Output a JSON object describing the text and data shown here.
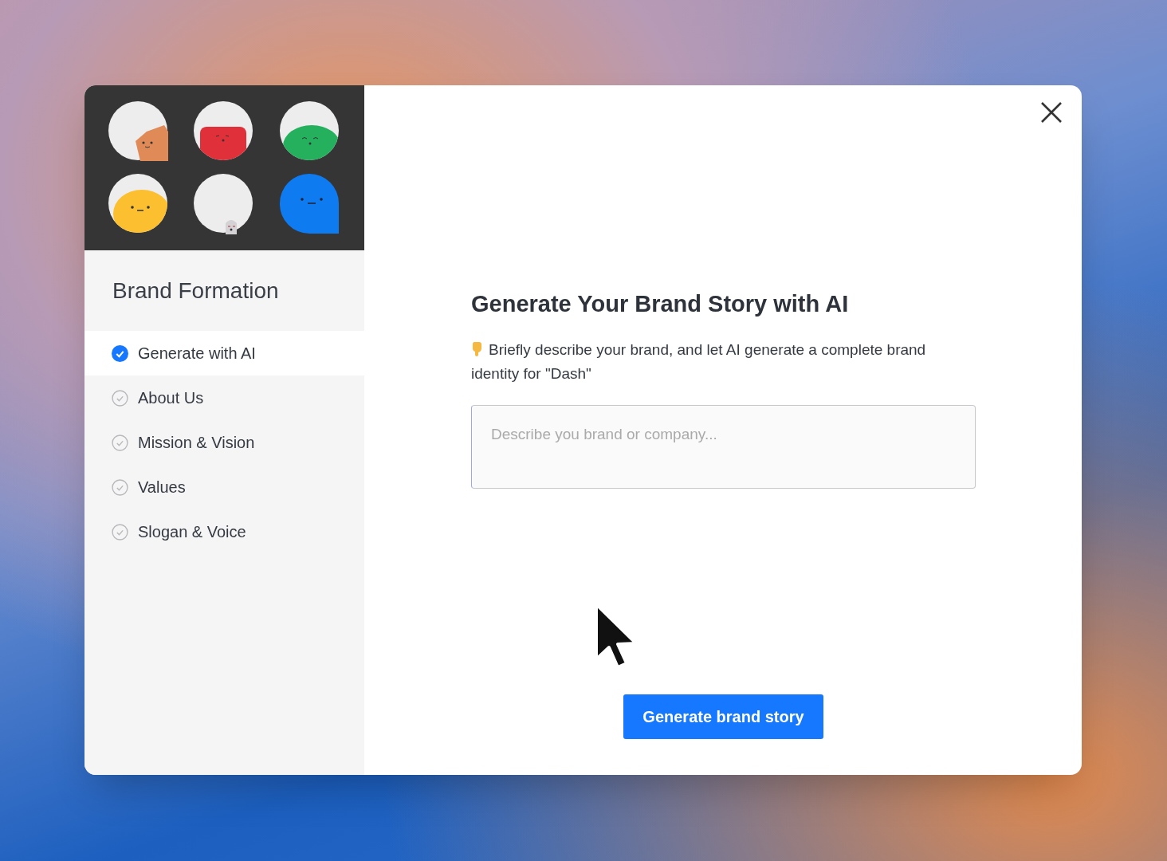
{
  "sidebar": {
    "title": "Brand Formation",
    "items": [
      {
        "label": "Generate with AI",
        "selected": true
      },
      {
        "label": "About Us",
        "selected": false
      },
      {
        "label": "Mission & Vision",
        "selected": false
      },
      {
        "label": "Values",
        "selected": false
      },
      {
        "label": "Slogan & Voice",
        "selected": false
      }
    ]
  },
  "main": {
    "heading": "Generate Your Brand Story with AI",
    "description": "Briefly describe your brand, and let AI generate a complete brand identity for \"Dash\"",
    "input": {
      "placeholder": "Describe you brand or company..."
    },
    "button": "Generate brand story"
  }
}
